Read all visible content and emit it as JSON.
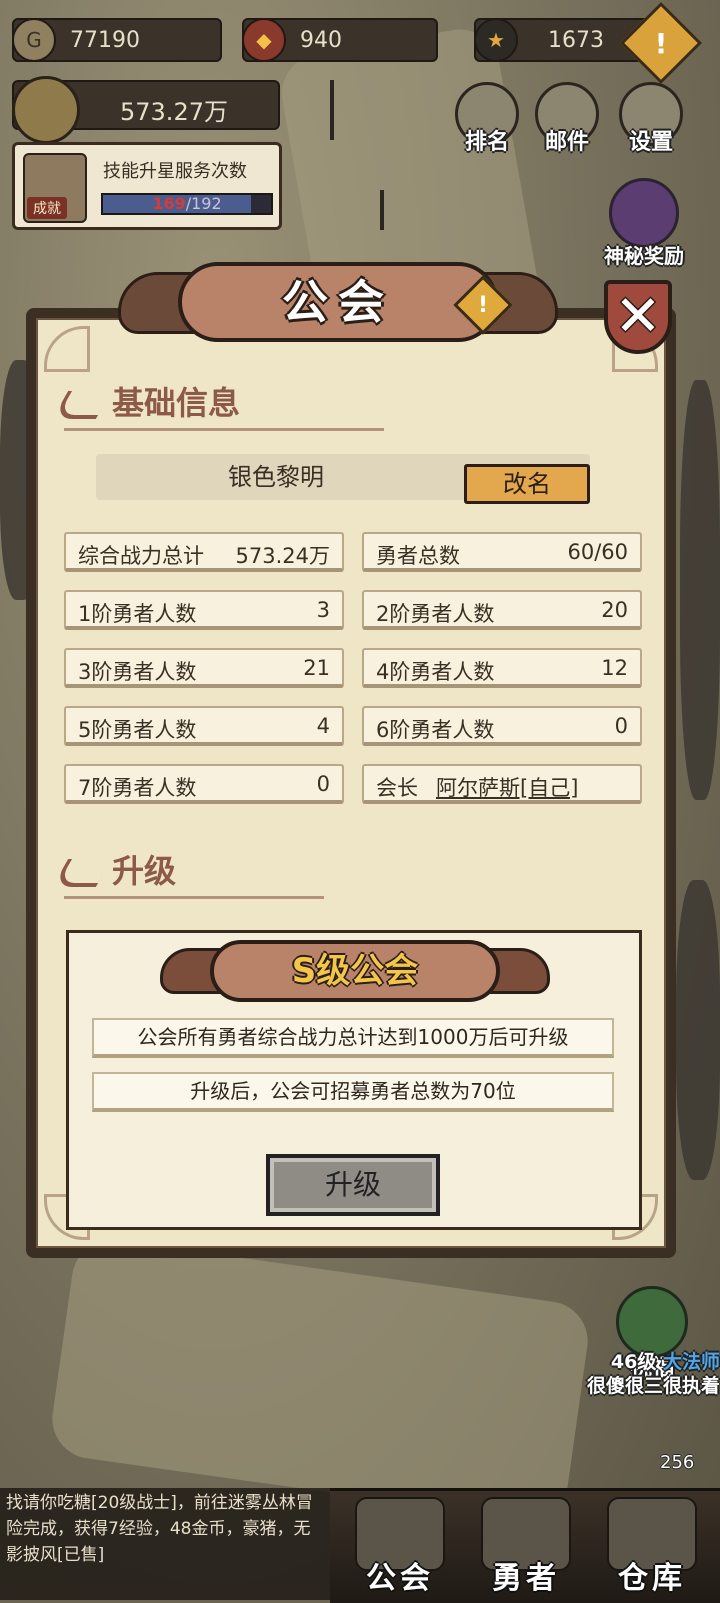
{
  "resources": {
    "gold": "77190",
    "gems": "940",
    "stars": "1673",
    "power": "573.27万"
  },
  "achievement": {
    "badge": "成就",
    "title": "技能升星服务次数",
    "current": "169",
    "sep_total": "/192",
    "progress_fraction": 0.88
  },
  "top_buttons": {
    "rank": "排名",
    "mail": "邮件",
    "settings": "设置",
    "mystery_reward": "神秘奖励"
  },
  "dialog": {
    "title": "公会",
    "close": "✕",
    "basic_header": "基础信息",
    "guild_name": "银色黎明",
    "rename": "改名",
    "stats": [
      {
        "key": "综合战力总计",
        "value": "573.24万"
      },
      {
        "key": "勇者总数",
        "value": "60/60"
      },
      {
        "key": "1阶勇者人数",
        "value": "3"
      },
      {
        "key": "2阶勇者人数",
        "value": "20"
      },
      {
        "key": "3阶勇者人数",
        "value": "21"
      },
      {
        "key": "4阶勇者人数",
        "value": "12"
      },
      {
        "key": "5阶勇者人数",
        "value": "4"
      },
      {
        "key": "6阶勇者人数",
        "value": "0"
      },
      {
        "key": "7阶勇者人数",
        "value": "0"
      },
      {
        "key": "会长",
        "value": "阿尔萨斯[自己]"
      }
    ],
    "upgrade_header": "升级",
    "rank_title": "S级公会",
    "condition1": "公会所有勇者综合战力总计达到1000万后可升级",
    "condition2": "升级后，公会可招募勇者总数为70位",
    "upgrade_button": "升级"
  },
  "side": {
    "blessing": "祝福",
    "hero_level": "46级",
    "hero_class": "大法师",
    "hero_name": "很傻很三很执着",
    "count": "256"
  },
  "log": "找请你吃糖[20级战士]，前往迷雾丛林冒险完成，获得7经验，48金币，豪猪，无影披风[已售]",
  "nav": {
    "guild": "公会",
    "heroes": "勇者",
    "storage": "仓库"
  },
  "colors": {
    "paper": "#efe5c7",
    "frame": "#3b2e22",
    "accent_brown": "#8c5a47",
    "rename_button": "#e3a84d",
    "rank_title": "#f3c64a",
    "progress_current": "#d13c3c"
  }
}
